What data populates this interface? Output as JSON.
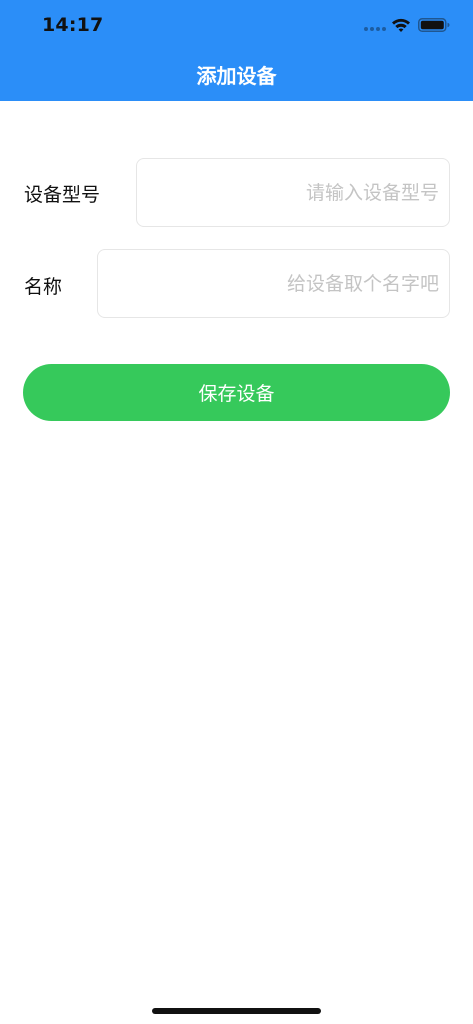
{
  "status_bar": {
    "time": "14:17",
    "wifi_icon": "wifi-icon",
    "battery_icon": "battery-icon"
  },
  "header": {
    "title": "添加设备",
    "background_color": "#2b8ef8"
  },
  "form": {
    "model": {
      "label": "设备型号",
      "value": "",
      "placeholder": "请输入设备型号"
    },
    "name": {
      "label": "名称",
      "value": "",
      "placeholder": "给设备取个名字吧"
    }
  },
  "actions": {
    "save_label": "保存设备",
    "save_color": "#36c95b"
  }
}
